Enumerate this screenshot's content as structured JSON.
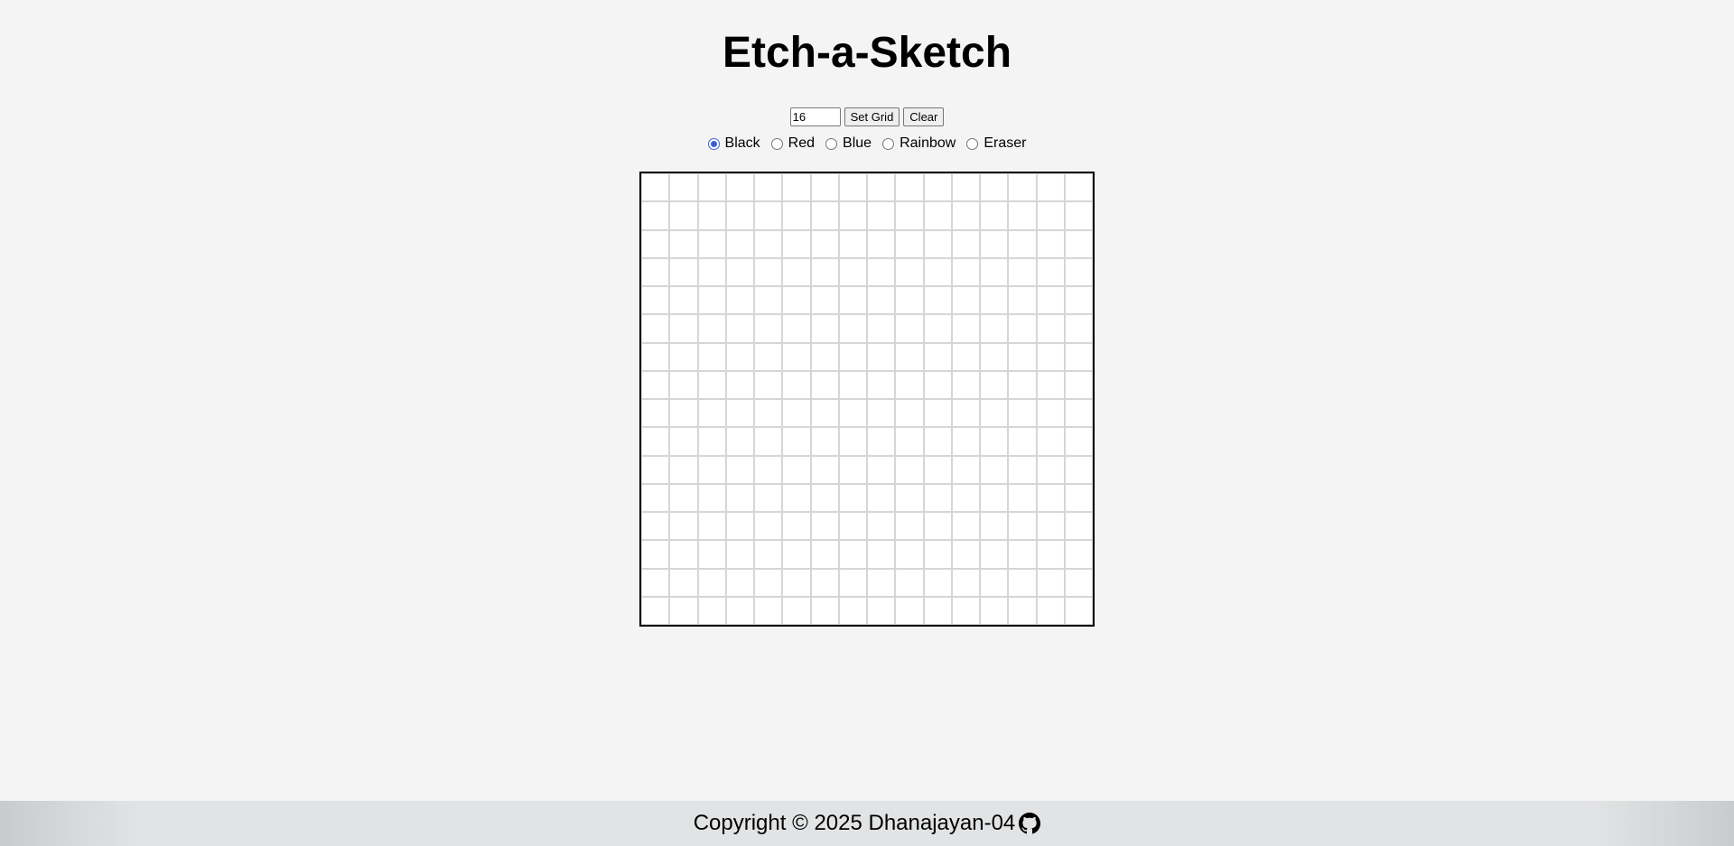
{
  "title": "Etch-a-Sketch",
  "controls": {
    "grid_size_value": "16",
    "set_grid_label": "Set Grid",
    "clear_label": "Clear"
  },
  "modes": [
    {
      "label": "Black",
      "checked": true
    },
    {
      "label": "Red",
      "checked": false
    },
    {
      "label": "Blue",
      "checked": false
    },
    {
      "label": "Rainbow",
      "checked": false
    },
    {
      "label": "Eraser",
      "checked": false
    }
  ],
  "grid": {
    "size": 16,
    "cell_color": "#ffffff",
    "border_color": "#d6d6d6"
  },
  "footer": {
    "copyright": "Copyright © 2025 Dhanajayan-04",
    "icon": "github-icon"
  }
}
